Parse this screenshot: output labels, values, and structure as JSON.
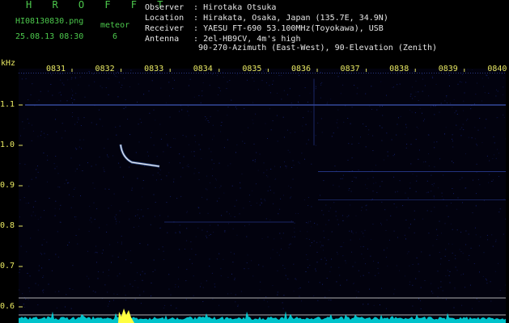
{
  "header": {
    "brand": "H R O F F T",
    "filename": "HI08130830.png",
    "datetime": "25.08.13 08:30",
    "meteor_label": "meteor",
    "meteor_count": "6"
  },
  "info": [
    {
      "key": "Observer",
      "value": "Hirotaka Otsuka"
    },
    {
      "key": "Location",
      "value": "Hirakata, Osaka, Japan (135.7E, 34.9N)"
    },
    {
      "key": "Receiver",
      "value": "YAESU FT-690 53.100MHz(Toyokawa), USB"
    },
    {
      "key": "Antenna",
      "value": "2el-HB9CV, 4m's high"
    },
    {
      "key": "",
      "value": "90-270-Azimuth (East-West), 90-Elevation (Zenith)"
    }
  ],
  "chart_data": {
    "type": "heatmap",
    "ylabel": "kHz",
    "y_ticks": [
      "1.1",
      "1.0",
      "0.9",
      "0.8",
      "0.7",
      "0.6"
    ],
    "x_ticks": [
      "0831",
      "0832",
      "0833",
      "0834",
      "0835",
      "0836",
      "0837",
      "0838",
      "0839",
      "0840"
    ],
    "colors": {
      "background": "#02020e",
      "noise": "#1a2a8a",
      "echo": "#ffffff",
      "spectrum": "#00d8e0",
      "spectrum_peak": "#ffff40",
      "reference": "#b0b0b0"
    }
  }
}
